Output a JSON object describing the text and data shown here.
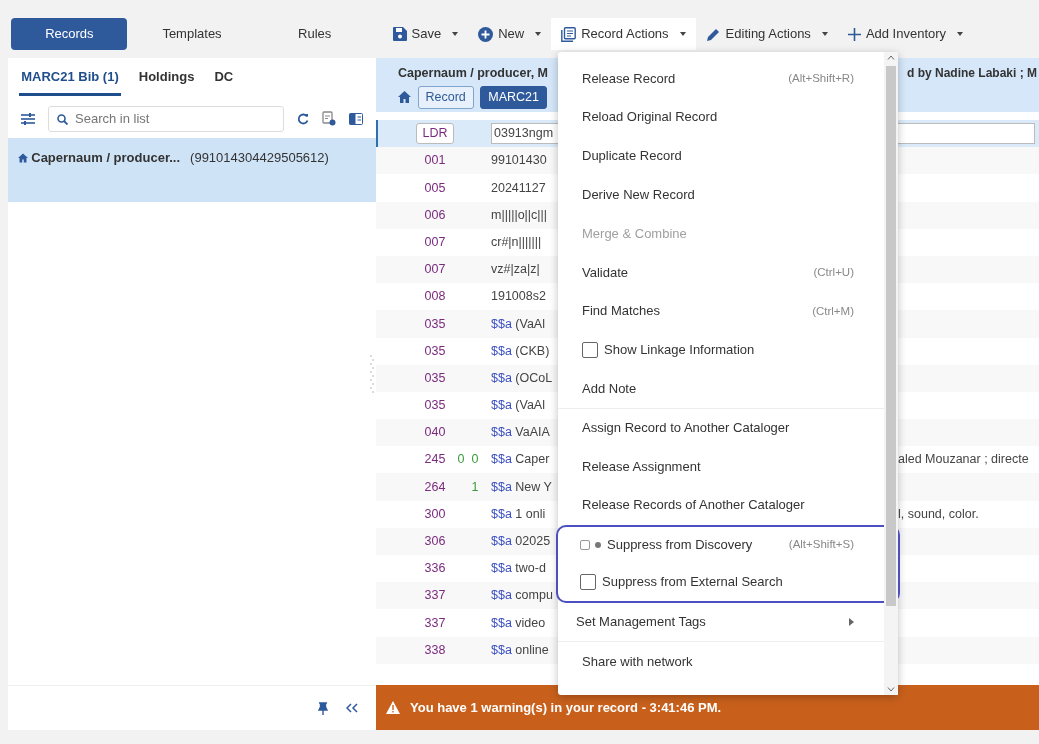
{
  "left_tabs": [
    {
      "label": "Records",
      "selected": true
    },
    {
      "label": "Templates",
      "selected": false
    },
    {
      "label": "Rules",
      "selected": false
    }
  ],
  "record_tabs": [
    {
      "label": "MARC21 Bib (1)",
      "selected": true
    },
    {
      "label": "Holdings",
      "selected": false
    },
    {
      "label": "DC",
      "selected": false
    }
  ],
  "search": {
    "placeholder": "Search in list"
  },
  "records": [
    {
      "title": "Capernaum / producer...",
      "id": "(991014304429505612)",
      "selected": true
    }
  ],
  "toolbar": [
    {
      "label": "Save",
      "open": false
    },
    {
      "label": "New",
      "open": false
    },
    {
      "label": "Record Actions",
      "open": true
    },
    {
      "label": "Editing Actions",
      "open": false
    },
    {
      "label": "Add Inventory",
      "open": false
    }
  ],
  "header": {
    "title_start": "Capernaum / producer, M",
    "title_end": "d by Nadine Labaki ; M",
    "badges": [
      {
        "label": "Record",
        "kind": "outline"
      },
      {
        "label": "MARC21",
        "kind": "filled"
      }
    ]
  },
  "fields": [
    {
      "tag": "LDR",
      "selected": true,
      "value": "03913ngm"
    },
    {
      "tag": "001",
      "selected": false,
      "value": "99101430"
    },
    {
      "tag": "005",
      "selected": false,
      "value": "20241127"
    },
    {
      "tag": "006",
      "selected": false,
      "value": "m|||||o||c|||"
    },
    {
      "tag": "007",
      "selected": false,
      "value": "cr#|n|||||||"
    },
    {
      "tag": "007",
      "selected": false,
      "value": "vz#|za|z|"
    },
    {
      "tag": "008",
      "selected": false,
      "value": "191008s2"
    },
    {
      "tag": "035",
      "selected": false,
      "subfield": "$$a",
      "value": "(VaAl"
    },
    {
      "tag": "035",
      "selected": false,
      "subfield": "$$a",
      "value": "(CKB)"
    },
    {
      "tag": "035",
      "selected": false,
      "subfield": "$$a",
      "value": "(OCoL"
    },
    {
      "tag": "035",
      "selected": false,
      "subfield": "$$a",
      "value": "(VaAl"
    },
    {
      "tag": "040",
      "selected": false,
      "subfield": "$$a",
      "value": "VaAIA"
    },
    {
      "tag": "245",
      "selected": false,
      "ind1": "0",
      "ind2": "0",
      "subfield": "$$a",
      "value": "Caper",
      "value_end": "aled Mouzanar ; directe"
    },
    {
      "tag": "264",
      "selected": false,
      "ind2": "1",
      "subfield": "$$a",
      "value": "New Y"
    },
    {
      "tag": "300",
      "selected": false,
      "subfield": "$$a",
      "value": "1 onli",
      "value_end": "l, sound, color."
    },
    {
      "tag": "306",
      "selected": false,
      "subfield": "$$a",
      "value": "02025"
    },
    {
      "tag": "336",
      "selected": false,
      "subfield": "$$a",
      "value": "two-d"
    },
    {
      "tag": "337",
      "selected": false,
      "subfield": "$$a",
      "value": "compu"
    },
    {
      "tag": "337",
      "selected": false,
      "subfield": "$$a",
      "value": "video"
    },
    {
      "tag": "338",
      "selected": false,
      "subfield": "$$a",
      "value": "online"
    }
  ],
  "menu": {
    "items": [
      {
        "label": "Release Record",
        "shortcut": "(Alt+Shift+R)",
        "kind": "action",
        "disabled": false,
        "separator": false,
        "highlighted": false
      },
      {
        "label": "Reload Original Record",
        "kind": "action",
        "disabled": false,
        "separator": false,
        "highlighted": false
      },
      {
        "label": "Duplicate Record",
        "kind": "action",
        "disabled": false,
        "separator": false,
        "highlighted": false
      },
      {
        "label": "Derive New Record",
        "kind": "action",
        "disabled": false,
        "separator": false,
        "highlighted": false
      },
      {
        "label": "Merge & Combine",
        "kind": "action",
        "disabled": true,
        "separator": false,
        "highlighted": false
      },
      {
        "label": "Validate",
        "shortcut": "(Ctrl+U)",
        "kind": "action",
        "disabled": false,
        "separator": false,
        "highlighted": false
      },
      {
        "label": "Find Matches",
        "shortcut": "(Ctrl+M)",
        "kind": "action",
        "disabled": false,
        "separator": false,
        "highlighted": false
      },
      {
        "label": "Show Linkage Information",
        "kind": "checkbox",
        "checked": false,
        "disabled": false,
        "separator": false,
        "highlighted": false
      },
      {
        "label": "Add Note",
        "kind": "action",
        "disabled": false,
        "separator": false,
        "highlighted": false
      },
      {
        "label": "Assign Record to Another Cataloger",
        "kind": "action",
        "disabled": false,
        "separator": true,
        "highlighted": false
      },
      {
        "label": "Release Assignment",
        "kind": "action",
        "disabled": false,
        "separator": false,
        "highlighted": false
      },
      {
        "label": "Release Records of Another Cataloger",
        "kind": "action",
        "disabled": false,
        "separator": false,
        "highlighted": false
      },
      {
        "label": "Suppress from Discovery",
        "shortcut": "(Alt+Shift+S)",
        "kind": "checkbox_dot",
        "checked": false,
        "disabled": false,
        "separator": false,
        "highlighted": true
      },
      {
        "label": "Suppress from External Search",
        "kind": "checkbox",
        "checked": false,
        "disabled": false,
        "separator": false,
        "highlighted": true
      },
      {
        "label": "Set Management Tags",
        "kind": "submenu",
        "disabled": false,
        "separator": false,
        "highlighted": false
      },
      {
        "label": "Share with network",
        "kind": "action",
        "disabled": false,
        "separator": true,
        "highlighted": false
      }
    ]
  },
  "warning": {
    "text": "You have 1 warning(s) in your record - 3:41:46 PM."
  }
}
